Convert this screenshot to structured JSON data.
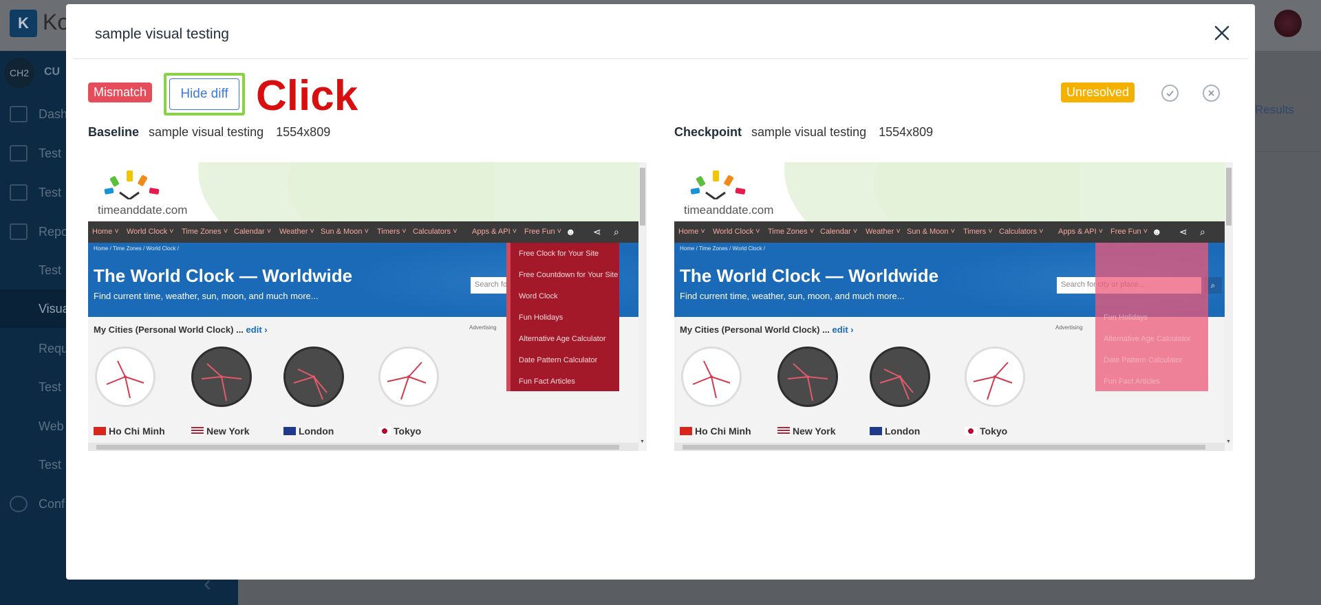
{
  "background": {
    "logo_initial": "K",
    "logo_text": "Ko",
    "avatar": "CH2",
    "avatar_label": "CU",
    "nav": [
      {
        "label": "Dash",
        "active": false
      },
      {
        "label": "Test",
        "active": false
      },
      {
        "label": "Test",
        "active": false
      },
      {
        "label": "Repo",
        "active": false
      },
      {
        "label": "Test",
        "active": false
      },
      {
        "label": "Visua",
        "active": true
      },
      {
        "label": "Requ",
        "active": false
      },
      {
        "label": "Test",
        "active": false
      },
      {
        "label": "Web",
        "active": false
      },
      {
        "label": "Test",
        "active": false
      },
      {
        "label": "Conf",
        "active": false
      }
    ],
    "main_link": "Results"
  },
  "modal": {
    "title": "sample visual testing",
    "status_badge": "Mismatch",
    "hide_diff_label": "Hide diff",
    "annotation": "Click",
    "resolution_badge": "Unresolved",
    "colors": {
      "mismatch": "#e54d5b",
      "unresolved": "#f5b100",
      "accent": "#3c79d8",
      "highlight_border": "#8ad14a",
      "annotation_text": "#d90f0f"
    }
  },
  "baseline": {
    "kind": "Baseline",
    "name": "sample visual testing",
    "resolution": "1554x809"
  },
  "checkpoint": {
    "kind": "Checkpoint",
    "name": "sample visual testing",
    "resolution": "1554x809"
  },
  "site": {
    "logo_text": "timeanddate.com",
    "nav": [
      "Home ˅",
      "World Clock ˅",
      "Time Zones ˅",
      "Calendar ˅",
      "Weather ˅",
      "Sun & Moon ˅",
      "Timers ˅",
      "Calculators ˅",
      "Apps & API ˅",
      "Free Fun ˅"
    ],
    "breadcrumbs": "Home  /  Time Zones  /  World Clock  /",
    "title": "The World Clock — Worldwide",
    "subtitle": "Find current time, weather, sun, moon, and much more...",
    "baseline_search_placeholder": "Search for",
    "checkpoint_search_placeholder": "Search for city or place...",
    "cities_heading": "My Cities (Personal World Clock) ...",
    "cities_edit": "edit ›",
    "advertising": "Advertising",
    "cities": [
      "Ho Chi Minh",
      "New York",
      "London",
      "Tokyo"
    ],
    "dropdown_items": [
      "Free Clock for Your Site",
      "Free Countdown for Your Site",
      "Word Clock",
      "Fun Holidays",
      "Alternative Age Calculator",
      "Date Pattern Calculator",
      "Fun Fact Articles"
    ]
  }
}
